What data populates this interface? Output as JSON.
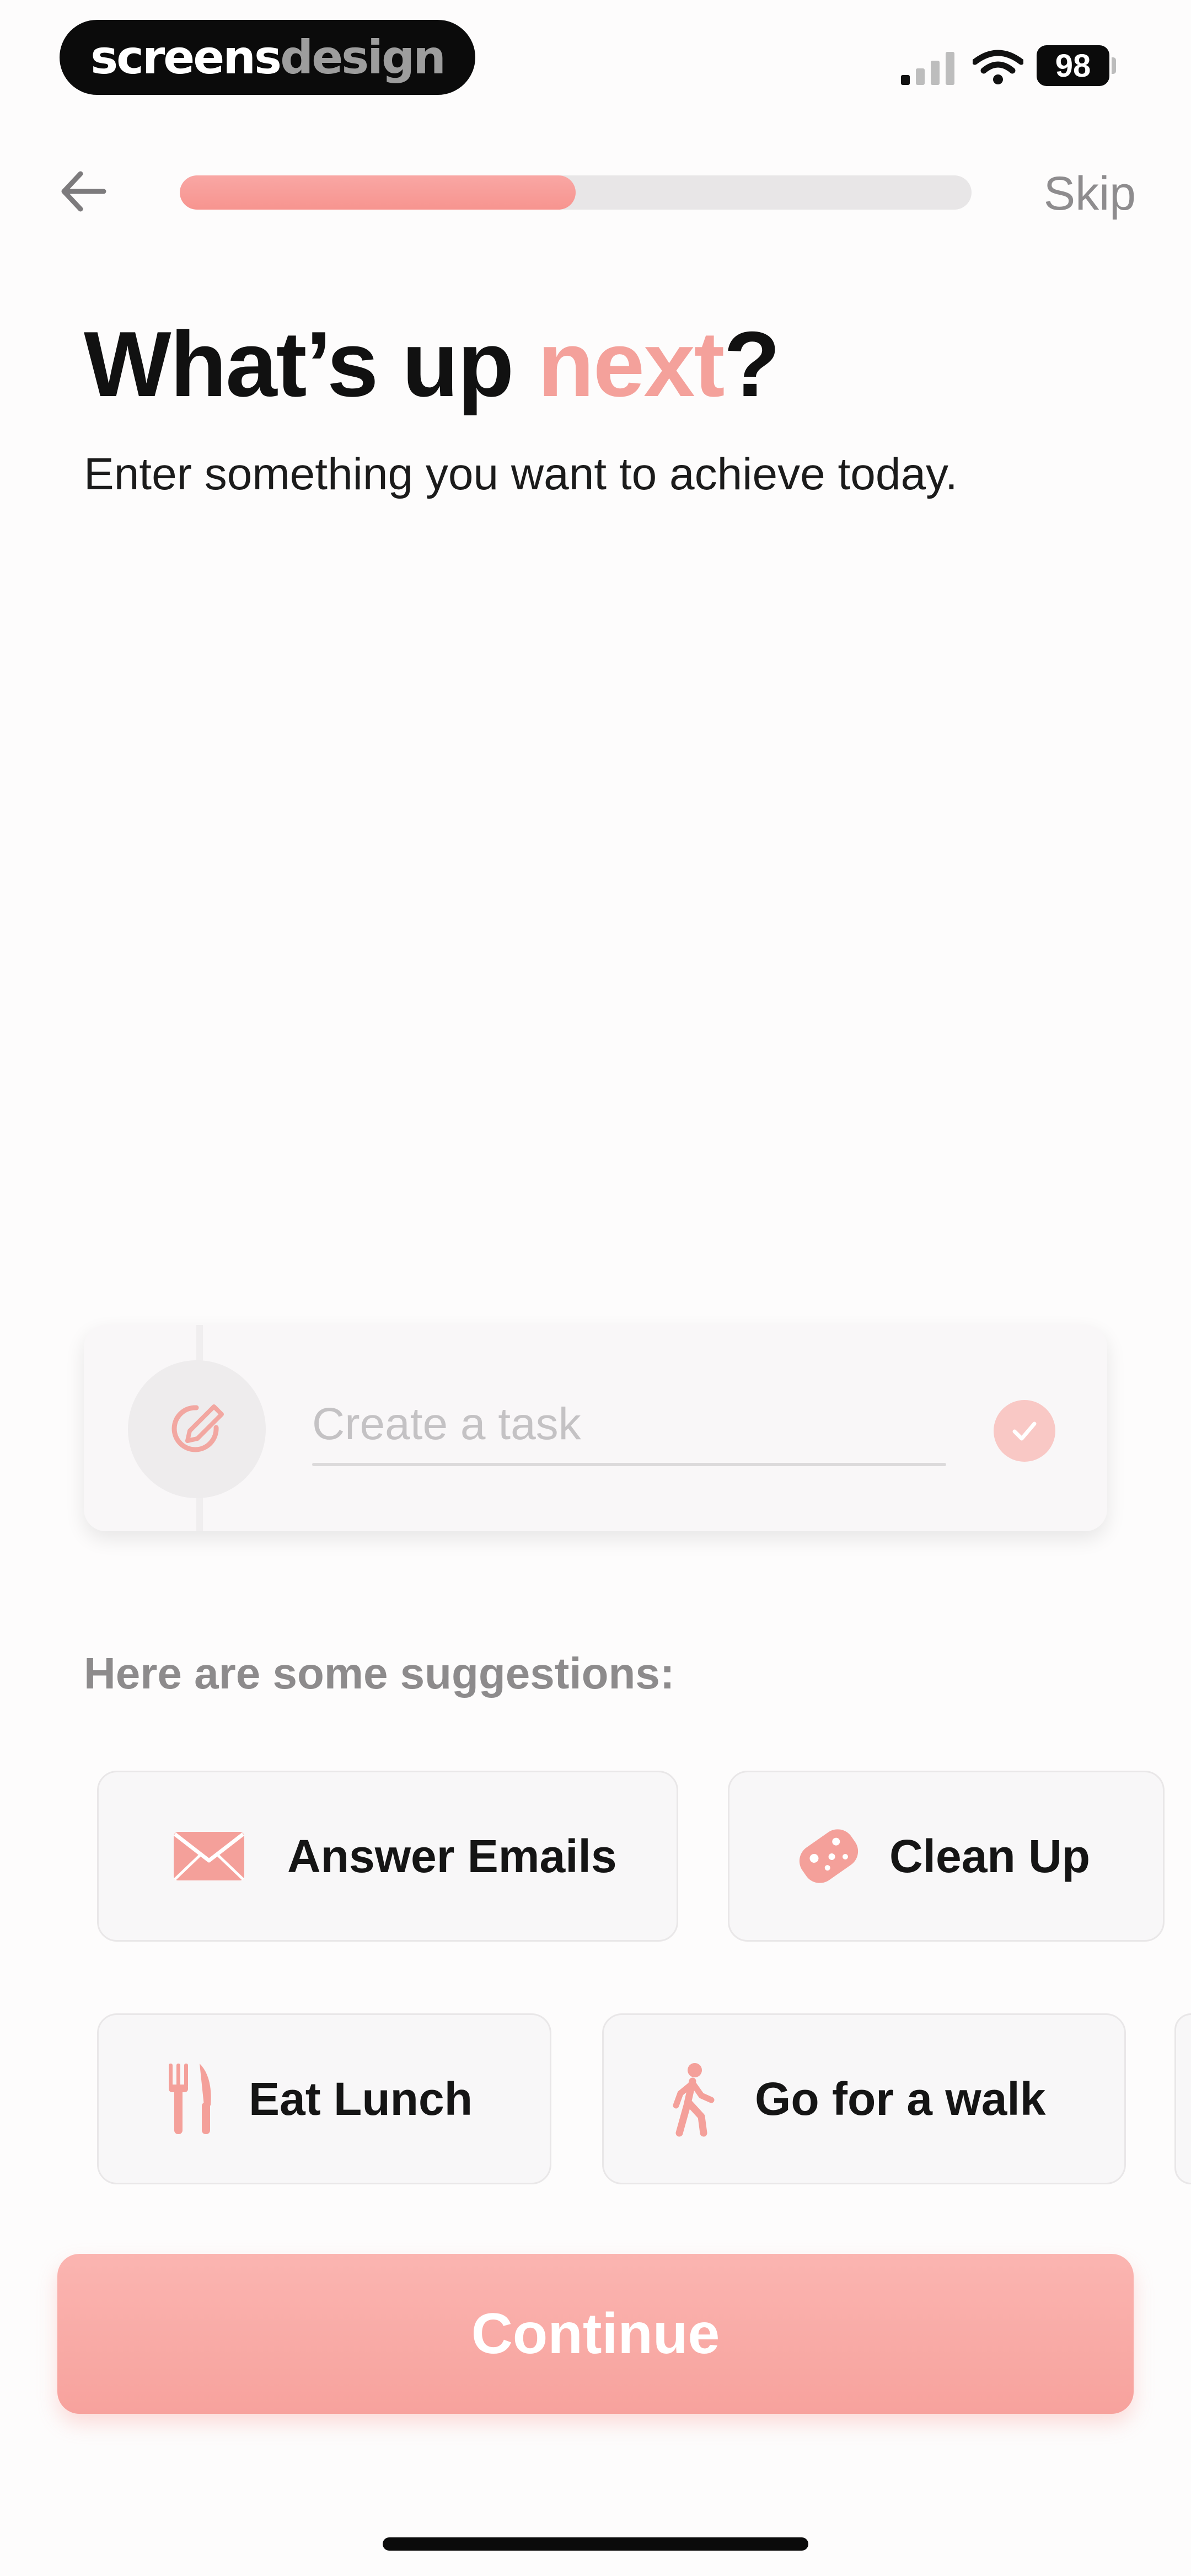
{
  "status_bar": {
    "watermark_part1": "screens",
    "watermark_part2": "design",
    "battery": "98"
  },
  "nav": {
    "progress": 0.5,
    "skip_label": "Skip"
  },
  "heading": {
    "title_prefix": "What’s up ",
    "title_accent": "next",
    "title_suffix": "?",
    "subtitle": "Enter something you want to achieve today."
  },
  "task": {
    "placeholder": "Create a task",
    "value": ""
  },
  "suggestions": {
    "label": "Here are some suggestions:",
    "items": [
      {
        "label": "Answer Emails",
        "icon": "envelope-icon"
      },
      {
        "label": "Clean Up",
        "icon": "sponge-icon"
      },
      {
        "label": "Eat Lunch",
        "icon": "fork-knife-icon"
      },
      {
        "label": "Go for a walk",
        "icon": "walking-person-icon"
      }
    ]
  },
  "continue_label": "Continue",
  "colors": {
    "accent": "#f4a19b",
    "button": "#f9aba6",
    "progress_track": "#e8e6e7"
  }
}
